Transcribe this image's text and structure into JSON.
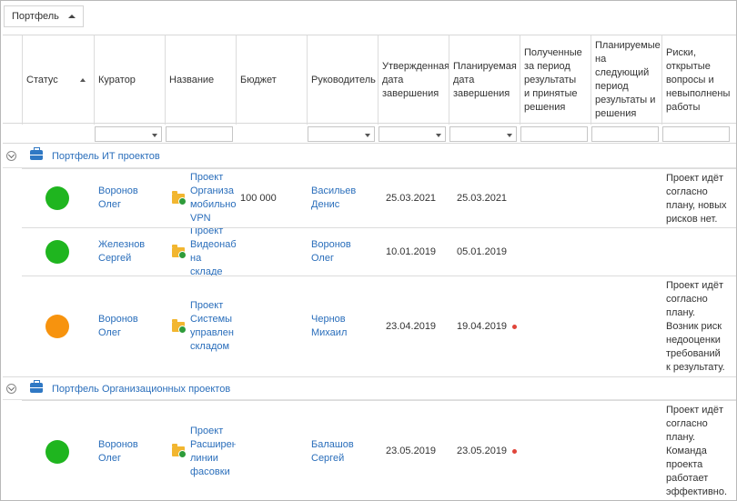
{
  "toolbar": {
    "portfolio_label": "Портфель"
  },
  "columns": {
    "status": "Статус",
    "curator": "Куратор",
    "name": "Название",
    "budget": "Бюджет",
    "manager": "Руководитель",
    "approved_date": "Утвержденная\nдата\nзавершения",
    "planned_date": "Планируемая\nдата\nзавершения",
    "results_received": "Полученные\nза период\nрезультаты\nи принятые\nрешения",
    "results_planned": "Планируемые\nна\nследующий\nпериод\nрезультаты и\nрешения",
    "risks": "Риски,\nоткрытые\nвопросы и\nневыполнены\nработы"
  },
  "groups": [
    {
      "title": "Портфель ИТ проектов",
      "rows": [
        {
          "status_color": "#1fb51f",
          "curator": "Воронов\nОлег",
          "name": "Проект\nОрганиза\nмобильно\nVPN",
          "budget": "100 000",
          "manager": "Васильев\nДенис",
          "approved": "25.03.2021",
          "planned": "25.03.2021",
          "overdue": false,
          "risks": "Проект идёт\nсогласно\nплану, новых\nрисков нет."
        },
        {
          "status_color": "#1fb51f",
          "curator": "Железнов\nСергей",
          "name": "Проект\nВидеонаб\nна складе",
          "budget": "",
          "manager": "Воронов\nОлег",
          "approved": "10.01.2019",
          "planned": "05.01.2019",
          "overdue": false,
          "risks": ""
        },
        {
          "status_color": "#f7930e",
          "curator": "Воронов\nОлег",
          "name": "Проект\nСистемы\nуправлен\nскладом",
          "budget": "",
          "manager": "Чернов\nМихаил",
          "approved": "23.04.2019",
          "planned": "19.04.2019",
          "overdue": true,
          "risks": "Проект идёт\nсогласно\nплану.\nВозник риск\nнедооценки\nтребований\nк результату."
        }
      ]
    },
    {
      "title": "Портфель Организационных проектов",
      "rows": [
        {
          "status_color": "#1fb51f",
          "curator": "Воронов\nОлег",
          "name": "Проект\nРасширен\nлинии\nфасовки",
          "budget": "",
          "manager": "Балашов\nСергей",
          "approved": "23.05.2019",
          "planned": "23.05.2019",
          "overdue": true,
          "risks": "Проект идёт\nсогласно\nплану.\nКоманда\nпроекта\nработает\nэффективно."
        }
      ]
    }
  ]
}
